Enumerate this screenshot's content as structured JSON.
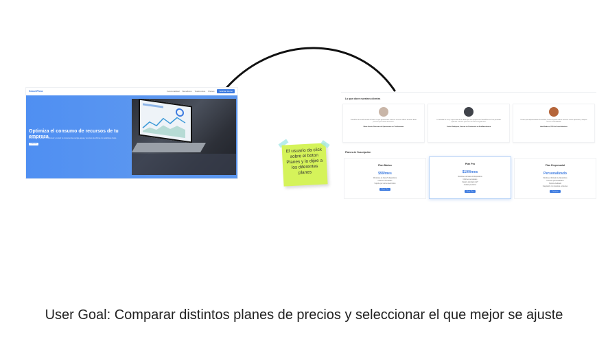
{
  "annotation": {
    "sticky_note": "El usuario da click sobre el boton Planes y lo dijire a los diferentes planes",
    "caption": "User Goal: Comparar distintos planes de precios y seleccionar el que mejor se ajuste"
  },
  "landing": {
    "brand": "SmartFlow",
    "nav": [
      "Funcionalidad",
      "Beneficios",
      "Testimonios",
      "Planes"
    ],
    "nav_cta": "Solicitar Demo",
    "hero_title": "Optimiza el consumo de recursos de tu empresa",
    "hero_subtitle": "SmartFlow te ayuda a monitorear y reducir el consumo de energía, agua y recursos de oficina con analíticas claras.",
    "hero_button": "Comenzar"
  },
  "plans_page": {
    "testimonials_title": "Lo que dicen nuestros clientes",
    "testimonials": [
      {
        "text": "SmartFlow ha revolucionado la forma en que gestionamos nuestros recursos. Ahora tenemos datos precisos para tomar decisiones.",
        "name": "María García, Directora de Operaciones en TechInnovate",
        "avatar_color": "#c9b6a8"
      },
      {
        "text": "La facilidad de uso y la precisión de los datos que nos proporciona SmartFlow nos han permitido optimizar nuestros procesos de manera significativa.",
        "name": "Carlos Rodríguez, Gerente de Producción en EcoManufactura",
        "avatar_color": "#40434a"
      },
      {
        "text": "Desde que implementamos SmartFlow, hemos logrado reducir nuestros costos operativos y mejorar nuestra sostenibilidad.",
        "name": "Ana Martínez, CEO de GreenSolutions",
        "avatar_color": "#b5653a"
      }
    ],
    "plans_title": "Planes de Suscripción",
    "plans": [
      {
        "name": "Plan Básico",
        "price": "$99/mes",
        "features": [
          "Monitoreo de hasta 5 dispositivos",
          "Informes mensuales",
          "Soporte por correo electrónico"
        ],
        "button": "Elegir Plan"
      },
      {
        "name": "Plan Pro",
        "price": "$199/mes",
        "features": [
          "Monitoreo de hasta 20 dispositivos",
          "Informes semanales",
          "Soporte prioritario 24/7",
          "Análisis predictivo"
        ],
        "button": "Elegir Plan"
      },
      {
        "name": "Plan Empresarial",
        "price": "Personalizado",
        "features": [
          "Monitoreo ilimitado de dispositivos",
          "Informes personalizados",
          "Soporte dedicado",
          "Integración con sistemas existentes"
        ],
        "button": "Contactar"
      }
    ]
  },
  "colors": {
    "accent": "#3d7be0",
    "hero_bg": "#5592f0",
    "sticky": "#d5f35a"
  }
}
